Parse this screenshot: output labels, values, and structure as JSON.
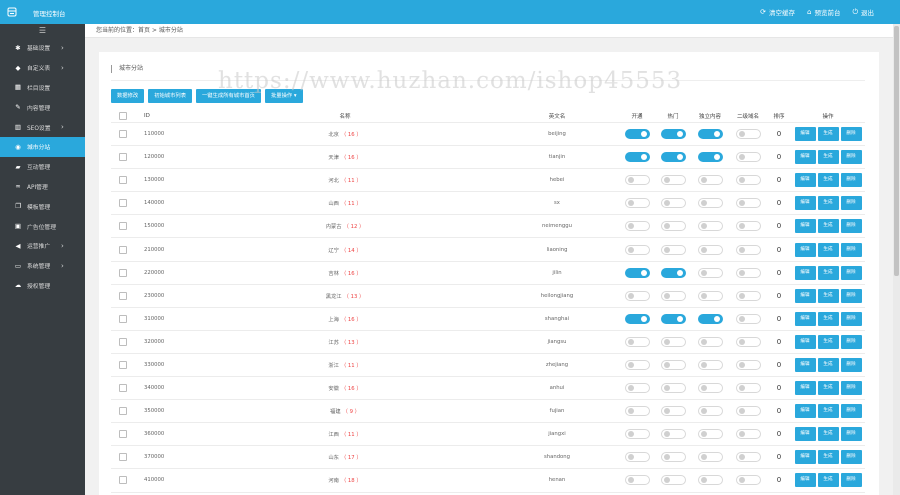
{
  "topbar": {
    "title": "管理控制台",
    "actions": [
      {
        "label": "清空缓存",
        "icon": "refresh-icon"
      },
      {
        "label": "预览前台",
        "icon": "home-icon"
      },
      {
        "label": "退出",
        "icon": "power-icon"
      }
    ]
  },
  "sidebar": {
    "items": [
      {
        "label": "基础设置",
        "icon": "gear-icon",
        "has_arrow": true
      },
      {
        "label": "自定义表",
        "icon": "tag-icon",
        "has_arrow": true
      },
      {
        "label": "栏目设置",
        "icon": "grid-icon",
        "has_arrow": false
      },
      {
        "label": "内容管理",
        "icon": "edit-icon",
        "has_arrow": false
      },
      {
        "label": "SEO设置",
        "icon": "chart-icon",
        "has_arrow": true
      },
      {
        "label": "城市分站",
        "icon": "globe-icon",
        "has_arrow": false
      },
      {
        "label": "互动管理",
        "icon": "comment-icon",
        "has_arrow": false
      },
      {
        "label": "API管理",
        "icon": "link-icon",
        "has_arrow": false
      },
      {
        "label": "模板管理",
        "icon": "copy-icon",
        "has_arrow": false
      },
      {
        "label": "广告位管理",
        "icon": "ad-icon",
        "has_arrow": false
      },
      {
        "label": "运营推广",
        "icon": "share-icon",
        "has_arrow": true
      },
      {
        "label": "系统管理",
        "icon": "monitor-icon",
        "has_arrow": true
      },
      {
        "label": "授权管理",
        "icon": "cloud-icon",
        "has_arrow": false
      }
    ],
    "active_index": 5
  },
  "breadcrumb": "您当前的位置：首页 > 城市分站",
  "panel": {
    "title": "城市分站",
    "buttons": [
      "数据修改",
      "初始城市列表",
      "一键生成所有城市首页",
      "批量操作"
    ]
  },
  "watermark": "https://www.huzhan.com/ishop45553",
  "table": {
    "headers": {
      "id": "ID",
      "name": "名称",
      "py": "英文名",
      "t1": "开通",
      "t2": "热门",
      "t3": "独立内容",
      "t4": "二级域名",
      "sort": "排序",
      "ops": "操作"
    },
    "op_labels": [
      "编辑",
      "生成",
      "删除"
    ],
    "rows": [
      {
        "id": "110000",
        "name": "北京",
        "count": "（ 16 ）",
        "py": "beijing",
        "t1": true,
        "t2": true,
        "t3": true,
        "t4": false,
        "sort": "0"
      },
      {
        "id": "120000",
        "name": "天津",
        "count": "（ 16 ）",
        "py": "tianjin",
        "t1": true,
        "t2": true,
        "t3": true,
        "t4": false,
        "sort": "0"
      },
      {
        "id": "130000",
        "name": "河北",
        "count": "（ 11 ）",
        "py": "hebei",
        "t1": false,
        "t2": false,
        "t3": false,
        "t4": false,
        "sort": "0"
      },
      {
        "id": "140000",
        "name": "山西",
        "count": "（ 11 ）",
        "py": "sx",
        "t1": false,
        "t2": false,
        "t3": false,
        "t4": false,
        "sort": "0"
      },
      {
        "id": "150000",
        "name": "内蒙古",
        "count": "（ 12 ）",
        "py": "neimenggu",
        "t1": false,
        "t2": false,
        "t3": false,
        "t4": false,
        "sort": "0"
      },
      {
        "id": "210000",
        "name": "辽宁",
        "count": "（ 14 ）",
        "py": "liaoning",
        "t1": false,
        "t2": false,
        "t3": false,
        "t4": false,
        "sort": "0"
      },
      {
        "id": "220000",
        "name": "吉林",
        "count": "（ 16 ）",
        "py": "jilin",
        "t1": true,
        "t2": true,
        "t3": false,
        "t4": false,
        "sort": "0"
      },
      {
        "id": "230000",
        "name": "黑龙江",
        "count": "（ 13 ）",
        "py": "heilongjiang",
        "t1": false,
        "t2": false,
        "t3": false,
        "t4": false,
        "sort": "0"
      },
      {
        "id": "310000",
        "name": "上海",
        "count": "（ 16 ）",
        "py": "shanghai",
        "t1": true,
        "t2": true,
        "t3": true,
        "t4": false,
        "sort": "0"
      },
      {
        "id": "320000",
        "name": "江苏",
        "count": "（ 13 ）",
        "py": "jiangsu",
        "t1": false,
        "t2": false,
        "t3": false,
        "t4": false,
        "sort": "0"
      },
      {
        "id": "330000",
        "name": "浙江",
        "count": "（ 11 ）",
        "py": "zhejiang",
        "t1": false,
        "t2": false,
        "t3": false,
        "t4": false,
        "sort": "0"
      },
      {
        "id": "340000",
        "name": "安徽",
        "count": "（ 16 ）",
        "py": "anhui",
        "t1": false,
        "t2": false,
        "t3": false,
        "t4": false,
        "sort": "0"
      },
      {
        "id": "350000",
        "name": "福建",
        "count": "（ 9 ）",
        "py": "fujian",
        "t1": false,
        "t2": false,
        "t3": false,
        "t4": false,
        "sort": "0"
      },
      {
        "id": "360000",
        "name": "江西",
        "count": "（ 11 ）",
        "py": "jiangxi",
        "t1": false,
        "t2": false,
        "t3": false,
        "t4": false,
        "sort": "0"
      },
      {
        "id": "370000",
        "name": "山东",
        "count": "（ 17 ）",
        "py": "shandong",
        "t1": false,
        "t2": false,
        "t3": false,
        "t4": false,
        "sort": "0"
      },
      {
        "id": "410000",
        "name": "河南",
        "count": "（ 18 ）",
        "py": "henan",
        "t1": false,
        "t2": false,
        "t3": false,
        "t4": false,
        "sort": "0"
      }
    ]
  },
  "colors": {
    "accent": "#2aa8dc",
    "sidebar_bg": "#373d41",
    "count_red": "#e44444"
  }
}
